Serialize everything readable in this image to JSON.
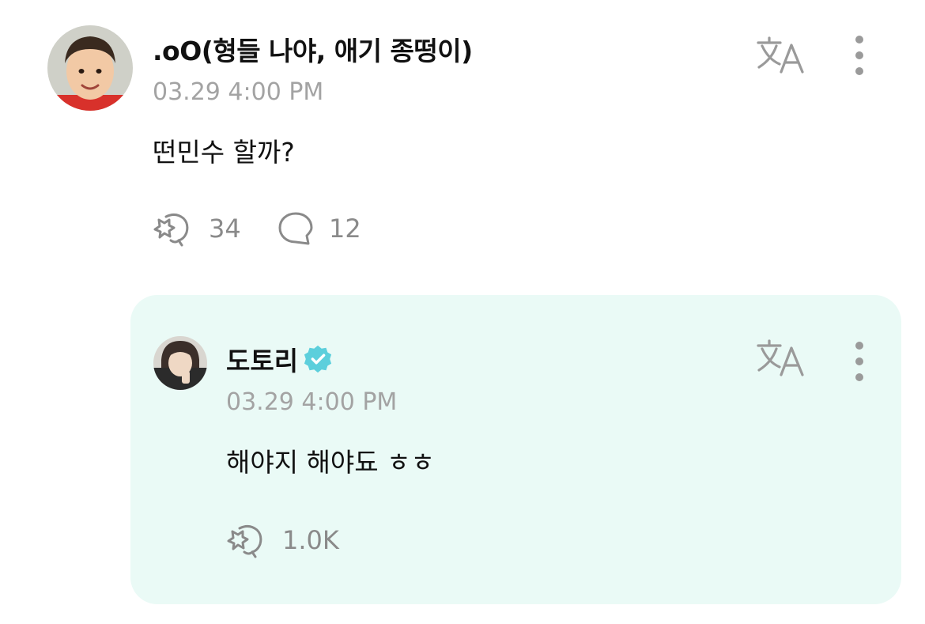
{
  "post": {
    "author": ".oO(형들 나야, 애기 종떵이)",
    "timestamp": "03.29 4:00 PM",
    "text": "떤민수 할까?",
    "like_count": "34",
    "comment_count": "12",
    "avatar_icon": "child-portrait-avatar",
    "translate_icon": "translate-icon",
    "more_icon": "more-vertical-icon"
  },
  "reply": {
    "author": "도토리",
    "verified": true,
    "timestamp": "03.29 4:00 PM",
    "text": "해야지 해야됴 ㅎㅎ",
    "like_count": "1.0K",
    "avatar_icon": "portrait-avatar"
  },
  "colors": {
    "reply_background": "#eafaf6",
    "verified_badge": "#5ccfdc",
    "muted_text": "#a3a3a3",
    "icon_gray": "#8a8a8a"
  }
}
